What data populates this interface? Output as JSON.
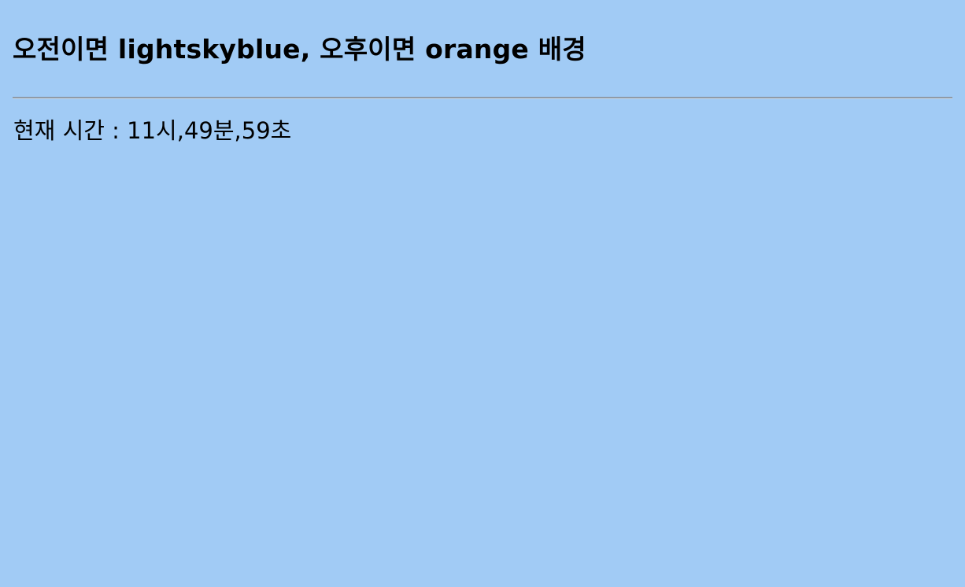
{
  "page": {
    "title": "오전이면 lightskyblue, 오후이면 orange 배경",
    "time_text": "현재 시간 : 11시,49분,59초"
  },
  "colors": {
    "background": "#a1cbf5",
    "text": "#000000",
    "divider": "#8f9aa6"
  }
}
